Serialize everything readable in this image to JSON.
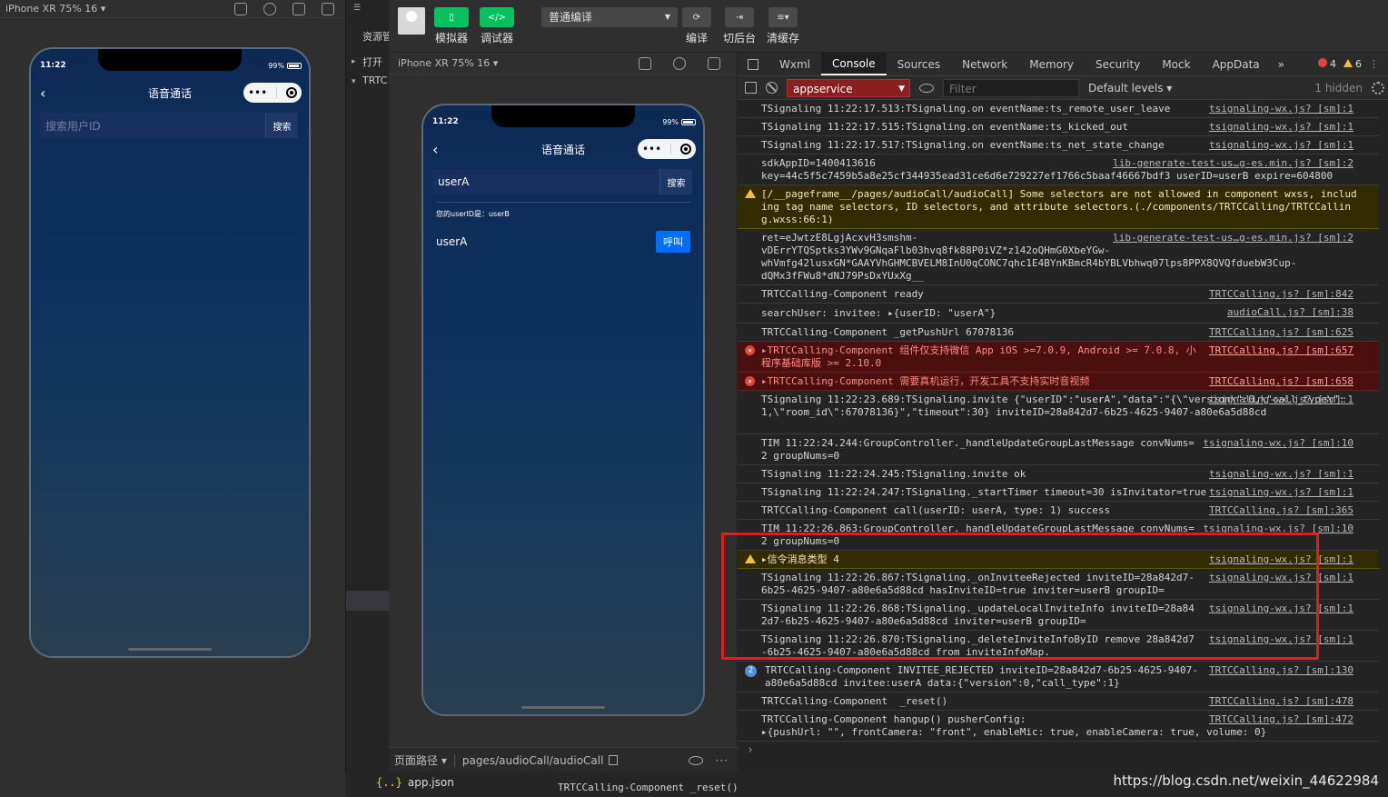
{
  "left_sim": {
    "device": "iPhone XR 75% 16 ▾",
    "time": "11:22",
    "battery": "99%",
    "title": "语音通话",
    "search_placeholder": "搜索用户ID",
    "search_btn": "搜索"
  },
  "tree": {
    "item1": "资源管",
    "item2": "打开",
    "item3": "TRTC"
  },
  "toolbar": {
    "simulator": "模拟器",
    "debugger": "调试器",
    "compile_mode": "普通编译",
    "compile": "编译",
    "background": "切后台",
    "clear_cache": "清缓存"
  },
  "sim": {
    "device": "iPhone XR 75% 16 ▾",
    "time": "11:22",
    "battery": "99%",
    "title": "语音通话",
    "search_value": "userA",
    "search_btn": "搜索",
    "uid_line": "您的userID是：userB",
    "result_name": "userA",
    "call_btn": "呼叫",
    "path_label": "页面路径 ▾",
    "path": "pages/audioCall/audioCall"
  },
  "devtools": {
    "tabs": [
      "Wxml",
      "Console",
      "Sources",
      "Network",
      "Memory",
      "Security",
      "Mock",
      "AppData"
    ],
    "more": "»",
    "errors": "4",
    "warnings": "6",
    "context": "appservice",
    "filter_placeholder": "Filter",
    "levels": "Default levels ▾",
    "hidden": "1 hidden"
  },
  "logs": [
    {
      "msg": "TSignaling 11:22:17.513:TSignaling.on eventName:ts_remote_user_leave",
      "src": "tsignaling-wx.js? [sm]:1"
    },
    {
      "msg": "TSignaling 11:22:17.515:TSignaling.on eventName:ts_kicked_out",
      "src": "tsignaling-wx.js? [sm]:1"
    },
    {
      "msg": "TSignaling 11:22:17.517:TSignaling.on eventName:ts_net_state_change",
      "src": "tsignaling-wx.js? [sm]:1"
    },
    {
      "msg": "sdkAppID=1400413616\nkey=44c5f5c7459b5a8e25cf344935ead31ce6d6e729227ef1766c5baaf46667bdf3 userID=userB expire=604800",
      "src": "lib-generate-test-us…g-es.min.js? [sm]:2"
    },
    {
      "msg": "[/__pageframe__/pages/audioCall/audioCall] Some selectors are not allowed in component wxss, including tag name selectors, ID selectors, and attribute selectors.(./components/TRTCCalling/TRTCCalling.wxss:66:1)",
      "src": ""
    },
    {
      "msg": "ret=eJwtzE8LgjAcxvH3smshm-\nvDErrYTQSptks3YWv9GNqaFlb03hvq8fk88P0iVZ*z142oQHmG0XbeYGw-\nwhVmfg42lusxGN*GAAYVhGHMCBVELM8InU0qCONC7qhc1E4BYnKBmcR4bYBLVbhwq07lps8PPX8QVQfduebW3Cup-\ndQMx3fFWu8*dNJ79PsDxYUxXg__",
      "src": "lib-generate-test-us…g-es.min.js? [sm]:2"
    },
    {
      "msg": "TRTCCalling-Component ready",
      "src": "TRTCCalling.js? [sm]:842"
    },
    {
      "msg": "searchUser: invitee: ▸{userID: \"userA\"}",
      "src": "audioCall.js? [sm]:38"
    },
    {
      "msg": "TRTCCalling-Component _getPushUrl 67078136",
      "src": "TRTCCalling.js? [sm]:625"
    },
    {
      "msg": "▸TRTCCalling-Component 组件仅支持微信 App iOS >=7.0.9, Android >= 7.0.8, 小程序基础库版 >= 2.10.0",
      "src": "TRTCCalling.js? [sm]:657"
    },
    {
      "msg": "▸TRTCCalling-Component 需要真机运行，开发工具不支持实时音视频",
      "src": "TRTCCalling.js? [sm]:658"
    },
    {
      "msg": "TSignaling 11:22:23.689:TSignaling.invite {\"userID\":\"userA\",\"data\":\"{\\\"version\\\":0,\\\"call_type\\\":1,\\\"room_id\\\":67078136}\",\"timeout\":30} inviteID=28a842d7-6b25-4625-9407-a80e6a5d88cd",
      "src": "tsignaling-wx.js? [sm]:1"
    },
    {
      "msg": "TIM 11:22:24.244:GroupController._handleUpdateGroupLastMessage convNums=2 groupNums=0",
      "src": "tsignaling-wx.js? [sm]:10"
    },
    {
      "msg": "TSignaling 11:22:24.245:TSignaling.invite ok",
      "src": "tsignaling-wx.js? [sm]:1"
    },
    {
      "msg": "TSignaling 11:22:24.247:TSignaling._startTimer timeout=30 isInvitator=true",
      "src": "tsignaling-wx.js? [sm]:1"
    },
    {
      "msg": "TRTCCalling-Component call(userID: userA, type: 1) success",
      "src": "TRTCCalling.js? [sm]:365"
    },
    {
      "msg": "TIM 11:22:26.863:GroupController._handleUpdateGroupLastMessage convNums=2 groupNums=0",
      "src": "tsignaling-wx.js? [sm]:10"
    },
    {
      "msg": "▸信令消息类型 4",
      "src": "tsignaling-wx.js? [sm]:1"
    },
    {
      "msg": "TSignaling 11:22:26.867:TSignaling._onInviteeRejected inviteID=28a842d7-6b25-4625-9407-a80e6a5d88cd hasInviteID=true inviter=userB groupID=",
      "src": "tsignaling-wx.js? [sm]:1"
    },
    {
      "msg": "TSignaling 11:22:26.868:TSignaling._updateLocalInviteInfo inviteID=28a842d7-6b25-4625-9407-a80e6a5d88cd inviter=userB groupID=",
      "src": "tsignaling-wx.js? [sm]:1"
    },
    {
      "msg": "TSignaling 11:22:26.870:TSignaling._deleteInviteInfoByID remove 28a842d7-6b25-4625-9407-a80e6a5d88cd from inviteInfoMap.",
      "src": "tsignaling-wx.js? [sm]:1"
    },
    {
      "msg": "TRTCCalling-Component INVITEE_REJECTED inviteID=28a842d7-6b25-4625-9407-a80e6a5d88cd invitee:userA data:{\"version\":0,\"call_type\":1}",
      "src": "TRTCCalling.js? [sm]:130",
      "count": "2"
    },
    {
      "msg": "TRTCCalling-Component  _reset()",
      "src": "TRTCCalling.js? [sm]:478"
    },
    {
      "msg": "TRTCCalling-Component hangup() pusherConfig:\n▸{pushUrl: \"\", frontCamera: \"front\", enableMic: true, enableCamera: true, volume: 0}",
      "src": "TRTCCalling.js? [sm]:472"
    }
  ],
  "bottom": {
    "file": "app.json",
    "tail": "TRTCCalling-Component  _reset()",
    "watermark": "https://blog.csdn.net/weixin_44622984"
  }
}
